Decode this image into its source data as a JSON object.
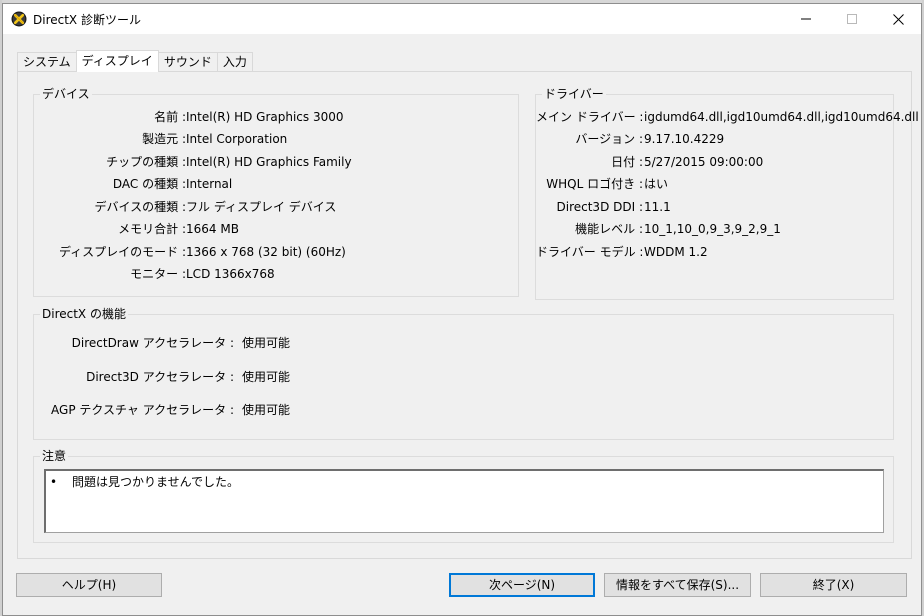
{
  "window": {
    "title": "DirectX 診断ツール"
  },
  "tabs": [
    {
      "label": "システム"
    },
    {
      "label": "ディスプレイ"
    },
    {
      "label": "サウンド"
    },
    {
      "label": "入力"
    }
  ],
  "device": {
    "heading": "デバイス",
    "rows": [
      {
        "label": "名前 :",
        "value": "Intel(R) HD Graphics 3000"
      },
      {
        "label": "製造元 :",
        "value": "Intel Corporation"
      },
      {
        "label": "チップの種類 :",
        "value": "Intel(R) HD Graphics Family"
      },
      {
        "label": "DAC の種類 :",
        "value": "Internal"
      },
      {
        "label": "デバイスの種類 :",
        "value": "フル ディスプレイ デバイス"
      },
      {
        "label": "メモリ合計 :",
        "value": "1664 MB"
      },
      {
        "label": "ディスプレイのモード :",
        "value": "1366 x 768 (32 bit) (60Hz)"
      },
      {
        "label": "モニター :",
        "value": "LCD 1366x768"
      }
    ]
  },
  "driver": {
    "heading": "ドライバー",
    "rows": [
      {
        "label": "メイン ドライバー :",
        "value": "igdumd64.dll,igd10umd64.dll,igd10umd64.dll"
      },
      {
        "label": "バージョン :",
        "value": "9.17.10.4229"
      },
      {
        "label": "日付 :",
        "value": "5/27/2015 09:00:00"
      },
      {
        "label": "WHQL ロゴ付き :",
        "value": "はい"
      },
      {
        "label": "Direct3D DDI :",
        "value": "11.1"
      },
      {
        "label": "機能レベル :",
        "value": "10_1,10_0,9_3,9_2,9_1"
      },
      {
        "label": "ドライバー モデル :",
        "value": "WDDM 1.2"
      }
    ]
  },
  "directx_features": {
    "heading": "DirectX の機能",
    "rows": [
      {
        "label": "DirectDraw アクセラレータ :",
        "value": "使用可能"
      },
      {
        "label": "Direct3D アクセラレータ :",
        "value": "使用可能"
      },
      {
        "label": "AGP テクスチャ アクセラレータ :",
        "value": "使用可能"
      }
    ]
  },
  "notes": {
    "heading": "注意",
    "items": [
      {
        "bullet": "•",
        "text": "問題は見つかりませんでした。"
      }
    ]
  },
  "buttons": {
    "help": "ヘルプ(H)",
    "next_page": "次ページ(N)",
    "save_all": "情報をすべて保存(S)...",
    "exit": "終了(X)"
  },
  "colors": {
    "default_button_border": "#0078d7",
    "window_bg": "#f0f0f0"
  },
  "icons": {
    "app": "directx-x-icon",
    "minimize": "minimize-icon",
    "maximize": "maximize-icon",
    "close": "close-icon"
  }
}
